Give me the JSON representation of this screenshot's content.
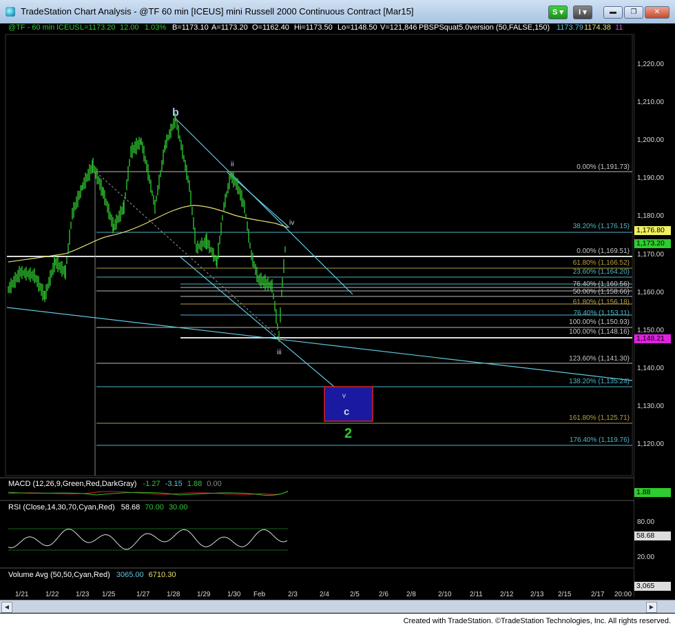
{
  "window": {
    "title": "TradeStation Chart Analysis - @TF 60 min [ICEUS] mini Russell 2000 Continuous Contract [Mar15]",
    "s_button": "S",
    "i_button": "I",
    "min_label": "▬",
    "restore_label": "❐",
    "close_label": "✕"
  },
  "info": {
    "symbol": "@TF - 60 min",
    "exchange": "ICEUS",
    "last": "L=1173.20",
    "change": "12.00",
    "pct": "1.03%",
    "bid": "B=1173.10",
    "ask": "A=1173.20",
    "open": "O=1162.40",
    "high": "Hi=1173.50",
    "low": "Lo=1148.50",
    "volume": "V=121,846",
    "indicator": "PBSPSquat5.0version (50,FALSE,150)",
    "v1": "1173.79",
    "v2": "1174.38",
    "v3": "11"
  },
  "price_scale": [
    "1,220.00",
    "1,210.00",
    "1,200.00",
    "1,190.00",
    "1,180.00",
    "1,170.00",
    "1,160.00",
    "1,150.00",
    "1,140.00",
    "1,130.00",
    "1,120.00"
  ],
  "price_tags": {
    "tag1": "1,176.80",
    "tag2": "1,173.20",
    "tag3": "1,148.21"
  },
  "fib_labels": [
    {
      "text": "0.00% (1,191.73)",
      "color": "#c8c8c8"
    },
    {
      "text": "38.20% (1,176.15)",
      "color": "#4fb8c8"
    },
    {
      "text": "0.00% (1,169.51)",
      "color": "#c8c8c8"
    },
    {
      "text": "61.80% (1,166.52)",
      "color": "#b8a040"
    },
    {
      "text": "23.60% (1,164.20)",
      "color": "#4fb8c8"
    },
    {
      "text": "76.40% (1,160.56)",
      "color": "#c8c8c8"
    },
    {
      "text": "50.00% (1,158.66)",
      "color": "#c8c8c8"
    },
    {
      "text": "61.80% (1,156.18)",
      "color": "#b8a040"
    },
    {
      "text": "76.40% (1,153.11)",
      "color": "#4fb8c8"
    },
    {
      "text": "100.00% (1,150.93)",
      "color": "#c8c8c8"
    },
    {
      "text": "100.00% (1,148.16)",
      "color": "#c8c8c8"
    },
    {
      "text": "123.60% (1,141.30)",
      "color": "#c8c8c8"
    },
    {
      "text": "138.20% (1,135.24)",
      "color": "#4fb8c8"
    },
    {
      "text": "161.80% (1,125.71)",
      "color": "#b8a040"
    },
    {
      "text": "176.40% (1,119.76)",
      "color": "#4fb8c8"
    }
  ],
  "waves": {
    "b": "b",
    "ii": "ii",
    "iii": "iii",
    "iv": "iv",
    "v": "v",
    "c": "c",
    "two": "2"
  },
  "macd": {
    "label": "MACD (12,26,9,Green,Red,DarkGray)",
    "v1": "-1.27",
    "v2": "-3.15",
    "v3": "1.88",
    "v4": "0.00",
    "tag": "1.88"
  },
  "rsi": {
    "label": "RSI (Close,14,30,70,Cyan,Red)",
    "v1": "58.68",
    "v2": "70.00",
    "v3": "30.00",
    "scale": [
      "80.00",
      "20.00"
    ],
    "tag": "58.68"
  },
  "volume": {
    "label": "Volume Avg (50,50,Cyan,Red)",
    "v1": "3065.00",
    "v2": "6710.30",
    "tag": "3,065"
  },
  "xaxis": [
    "1/21",
    "1/22",
    "1/23",
    "1/25",
    "1/27",
    "1/28",
    "1/29",
    "1/30",
    "Feb",
    "2/3",
    "2/4",
    "2/5",
    "2/6",
    "2/8",
    "2/10",
    "2/11",
    "2/12",
    "2/13",
    "2/15",
    "2/17",
    "20:00"
  ],
  "status": "Created with TradeStation. ©TradeStation Technologies, Inc. All rights reserved.",
  "colors": {
    "bars": "#2fbf2f",
    "trendline": "#5fc8e0",
    "ma": "#e8e070",
    "fib_gray": "#c8c8c8",
    "fib_gold": "#b8a040",
    "wave_text": "#a8c8f0",
    "green_label": "#2ecc2e"
  }
}
